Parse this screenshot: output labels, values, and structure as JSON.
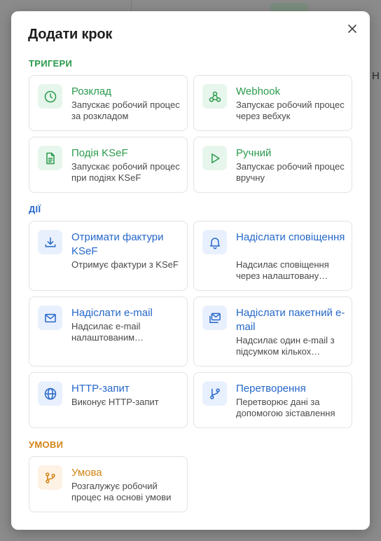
{
  "background": {
    "partial_letter": "Н"
  },
  "modal": {
    "title": "Додати крок",
    "close_icon": "close-icon"
  },
  "sections": {
    "triggers": "ТРИГЕРИ",
    "actions": "ДІЇ",
    "conditions": "УМОВИ"
  },
  "colors": {
    "trigger_accent": "#2a9a4c",
    "action_accent": "#2567c9",
    "condition_accent": "#d28416"
  },
  "triggers": [
    {
      "title": "Розклад",
      "desc": "Запускає робочий процес за розкладом",
      "icon": "clock-icon"
    },
    {
      "title": "Webhook",
      "desc": "Запускає робочий процес через вебхук",
      "icon": "webhook-icon"
    },
    {
      "title": "Подія KSeF",
      "desc": "Запускає робочий процес при подіях KSeF",
      "icon": "document-icon"
    },
    {
      "title": "Ручний",
      "desc": "Запускає робочий процес вручну",
      "icon": "play-icon"
    }
  ],
  "actions": [
    {
      "title": "Отримати фактури KSeF",
      "desc": "Отримує фактури з KSeF",
      "icon": "download-icon"
    },
    {
      "title": "Надіслати сповіщення",
      "desc": "Надсилає сповіщення через налаштовану…",
      "icon": "bell-icon"
    },
    {
      "title": "Надіслати e-mail",
      "desc": "Надсилає e-mail налаштованим…",
      "icon": "mail-icon"
    },
    {
      "title": "Надіслати пакетний e-mail",
      "desc": "Надсилає один e-mail з підсумком кількох…",
      "icon": "mail-stack-icon"
    },
    {
      "title": "HTTP-запит",
      "desc": "Виконує HTTP-запит",
      "icon": "globe-icon"
    },
    {
      "title": "Перетворення",
      "desc": "Перетворює дані за допомогою зіставлення",
      "icon": "branch-icon"
    }
  ],
  "conditions": [
    {
      "title": "Умова",
      "desc": "Розгалужує робочий процес на основі умови",
      "icon": "git-branch-icon"
    }
  ]
}
